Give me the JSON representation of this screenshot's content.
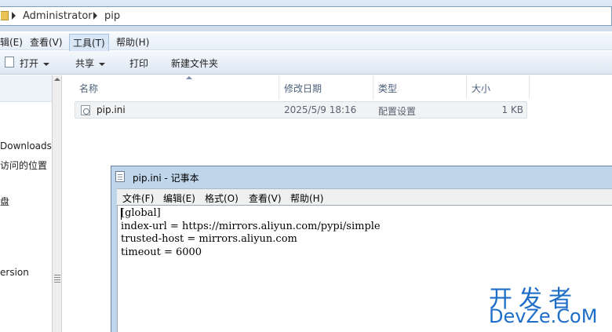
{
  "explorer": {
    "breadcrumbs": [
      "Administrator",
      "pip"
    ],
    "menu": [
      "辑(E)",
      "查看(V)",
      "工具(T)",
      "帮助(H)"
    ],
    "toolbar": {
      "open": "打开",
      "share": "共享",
      "print": "打印",
      "new_folder": "新建文件夹"
    },
    "nav_items": [
      "Downloads",
      "访问的位置",
      "盘",
      "ersion"
    ],
    "columns": [
      "名称",
      "修改日期",
      "类型",
      "大小"
    ],
    "files": [
      {
        "name": "pip.ini",
        "modified": "2025/5/9 18:16",
        "type": "配置设置",
        "size": "1 KB"
      }
    ]
  },
  "notepad": {
    "title": "pip.ini - 记事本",
    "menu": [
      "文件(F)",
      "编辑(E)",
      "格式(O)",
      "查看(V)",
      "帮助(H)"
    ],
    "lines": [
      "[global]",
      "index-url = https://mirrors.aliyun.com/pypi/simple",
      "trusted-host = mirrors.aliyun.com",
      "timeout = 6000"
    ]
  },
  "watermark": {
    "cn": "开发者",
    "en": "DevZe.CoM"
  },
  "colors": {
    "watermark": "#1e6ec8",
    "explorer_band": "#dfe9f5",
    "notepad_frame": "#bfd5ea"
  }
}
